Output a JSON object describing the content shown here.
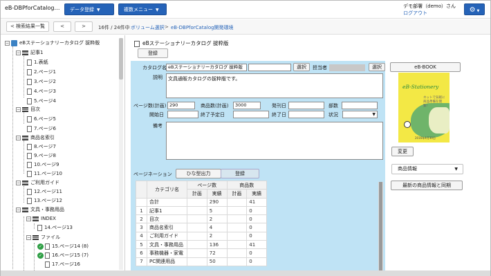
{
  "header": {
    "app_title": "eB-DBPforCatalog…",
    "data_menu": "データ登録",
    "multi_menu": "複数メニュー",
    "user_line": "デモ部署（demo）さん",
    "logout": "ログアウト",
    "settings_icon": "gear-icon"
  },
  "nav": {
    "back_label": "< 検索結果一覧",
    "prev_label": "<",
    "next_label": ">",
    "page_count": "16件 / 24件中",
    "crumb1": "ボリューム選択",
    "crumb_sep": ">",
    "crumb2": "eB-DBPforCatalog開発環境"
  },
  "tree": [
    {
      "label": "eBステーショナリーカタログ 拔粋版"
    },
    {
      "label": "記事1"
    },
    {
      "label": "1.表紙"
    },
    {
      "label": "2.ページ1"
    },
    {
      "label": "3.ページ2"
    },
    {
      "label": "4.ページ3"
    },
    {
      "label": "5.ページ4"
    },
    {
      "label": "目次"
    },
    {
      "label": "6.ページ5"
    },
    {
      "label": "7.ページ6"
    },
    {
      "label": "商品名索引"
    },
    {
      "label": "8.ページ7"
    },
    {
      "label": "9.ページ8"
    },
    {
      "label": "10.ページ9"
    },
    {
      "label": "11.ページ10"
    },
    {
      "label": "ご利用ガイド"
    },
    {
      "label": "12.ページ11"
    },
    {
      "label": "13.ページ12"
    },
    {
      "label": "文具・事務用品"
    },
    {
      "label": "INDEX"
    },
    {
      "label": "14.ページ13"
    },
    {
      "label": "ファイル"
    },
    {
      "label": "15.ページ14 (8)"
    },
    {
      "label": "16.ページ15 (7)"
    },
    {
      "label": "17.ページ16"
    }
  ],
  "main": {
    "title": "eBステーショナリーカタログ 拔粋版",
    "register_button": "登録",
    "catalog_name_label": "カタログ名",
    "catalog_name_value": "eBステーショナリーカタログ 拔粋版",
    "select_button": "選択",
    "person_label": "担当者",
    "select_button2": "選択",
    "description_label": "説明",
    "description_value": "文具通販カタログの拔粋版です。",
    "pages_plan_label": "ページ数(計画)",
    "pages_plan_value": "290",
    "items_plan_label": "商品数(計画)",
    "items_plan_value": "3000",
    "issue_date_label": "発刊日",
    "copies_label": "部数",
    "start_date_label": "開始日",
    "end_plan_label": "終了予定日",
    "end_date_label": "終了日",
    "status_label": "状況",
    "remarks_label": "備考",
    "pagination_label": "ページネーション",
    "template_output_button": "ひな型出力",
    "pg_register_button": "登録"
  },
  "pagination_table": {
    "headers": {
      "category": "カテゴリ名",
      "pages": "ページ数",
      "items": "商品数",
      "plan": "計画",
      "actual": "実績"
    },
    "rows": [
      {
        "idx": "",
        "name": "合計",
        "pages_plan": "",
        "pages_actual": "290",
        "items_plan": "",
        "items_actual": "41"
      },
      {
        "idx": "1",
        "name": "記事1",
        "pages_plan": "",
        "pages_actual": "5",
        "items_plan": "",
        "items_actual": "0"
      },
      {
        "idx": "2",
        "name": "目次",
        "pages_plan": "",
        "pages_actual": "2",
        "items_plan": "",
        "items_actual": "0"
      },
      {
        "idx": "3",
        "name": "商品名索引",
        "pages_plan": "",
        "pages_actual": "4",
        "items_plan": "",
        "items_actual": "0"
      },
      {
        "idx": "4",
        "name": "ご利用ガイド",
        "pages_plan": "",
        "pages_actual": "2",
        "items_plan": "",
        "items_actual": "0"
      },
      {
        "idx": "5",
        "name": "文具・事務用品",
        "pages_plan": "",
        "pages_actual": "136",
        "items_plan": "",
        "items_actual": "41"
      },
      {
        "idx": "6",
        "name": "事務機器・家電",
        "pages_plan": "",
        "pages_actual": "72",
        "items_plan": "",
        "items_actual": "0"
      },
      {
        "idx": "7",
        "name": "PC関連用品",
        "pages_plan": "",
        "pages_actual": "50",
        "items_plan": "",
        "items_actual": "0"
      }
    ]
  },
  "side": {
    "ebook_button": "eB-BOOK",
    "cover_brand": "eB-Stationery",
    "cover_subtitle": "ネットで気軽に商品準備を閲覧！",
    "cover_footer": "2016年4月30日",
    "change_button": "変更",
    "product_info_select": "商品情報",
    "sync_button": "最新の商品情報と同期"
  },
  "colors": {
    "accent": "#2563b8",
    "panel": "#bfe3f5",
    "check": "#2e9e44"
  }
}
